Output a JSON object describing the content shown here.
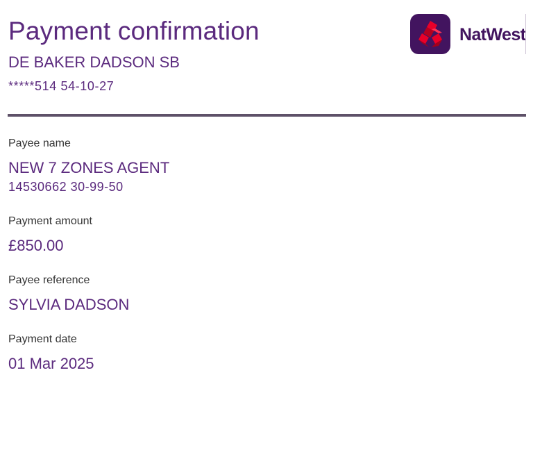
{
  "header": {
    "title": "Payment confirmation",
    "account_name": "DE BAKER DADSON SB",
    "account_number": "*****514 54-10-27"
  },
  "brand": {
    "logo_text": "NatWest",
    "logo_icon": "natwest-cubes-icon",
    "colors": {
      "brand_purple": "#42145f",
      "text_purple": "#5b2a7e",
      "logo_red": "#e90029",
      "divider": "#5e5168"
    }
  },
  "details": {
    "payee_name": {
      "label": "Payee name",
      "value": "NEW 7 ZONES AGENT",
      "account": "14530662 30-99-50"
    },
    "payment_amount": {
      "label": "Payment amount",
      "value": "£850.00"
    },
    "payee_reference": {
      "label": "Payee reference",
      "value": "SYLVIA DADSON"
    },
    "payment_date": {
      "label": "Payment date",
      "value": "01 Mar 2025"
    }
  }
}
